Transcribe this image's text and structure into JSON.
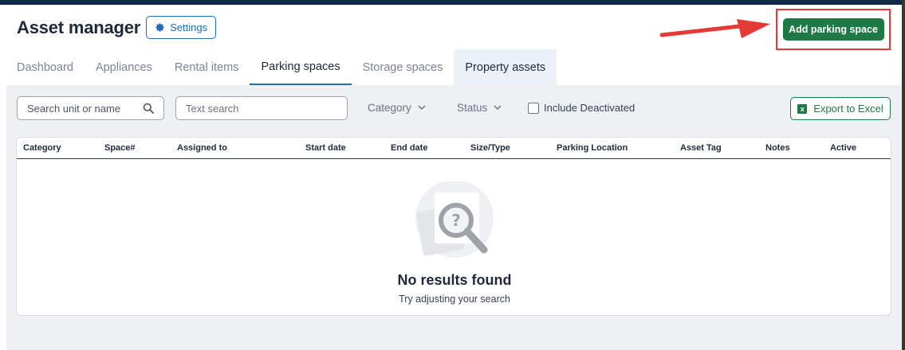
{
  "header": {
    "title": "Asset manager",
    "settings_label": "Settings",
    "add_label": "Add parking space"
  },
  "tabs": [
    {
      "label": "Dashboard"
    },
    {
      "label": "Appliances"
    },
    {
      "label": "Rental items"
    },
    {
      "label": "Parking spaces"
    },
    {
      "label": "Storage spaces"
    },
    {
      "label": "Property assets"
    }
  ],
  "active_tab": "Parking spaces",
  "filters": {
    "unit_search_placeholder": "Search unit or name",
    "text_search_placeholder": "Text search",
    "category_label": "Category",
    "status_label": "Status",
    "include_deactivated_label": "Include Deactivated",
    "include_deactivated_checked": false,
    "export_label": "Export to Excel"
  },
  "table": {
    "columns": [
      "Category",
      "Space#",
      "Assigned to",
      "Start date",
      "End date",
      "Size/Type",
      "Parking Location",
      "Asset Tag",
      "Notes",
      "Active"
    ],
    "rows": []
  },
  "empty_state": {
    "title": "No results found",
    "subtitle": "Try adjusting your search"
  },
  "colors": {
    "primary_blue": "#1f6db5",
    "green": "#1e7a45",
    "highlight_red": "#e53935",
    "navy": "#0f2a44"
  },
  "icons": {
    "settings": "gear-icon",
    "search": "search-icon",
    "dropdown": "chevron-down-icon",
    "export": "excel-icon",
    "empty": "magnifier-question-icon"
  }
}
